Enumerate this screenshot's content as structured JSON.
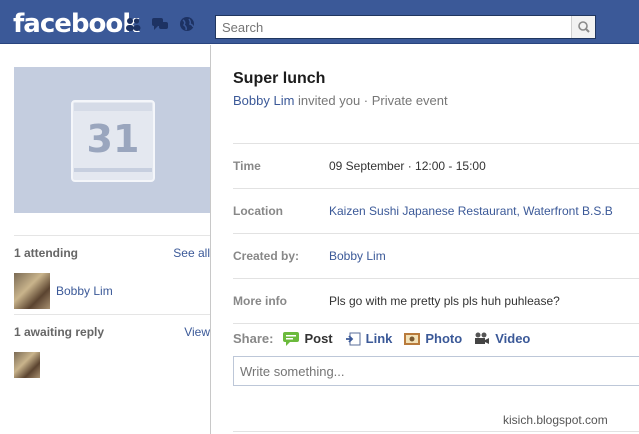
{
  "header": {
    "logo": "facebook",
    "search_placeholder": "Search"
  },
  "left": {
    "calendar_day": "31",
    "attending": {
      "heading": "1 attending",
      "link": "See all",
      "person": "Bobby Lim"
    },
    "awaiting": {
      "heading": "1 awaiting reply",
      "link": "View"
    }
  },
  "event": {
    "title": "Super lunch",
    "host": "Bobby Lim",
    "invite_text": "invited you · Private event",
    "rows": [
      {
        "label": "Time",
        "value": "09 September · 12:00 - 15:00"
      },
      {
        "label": "Location",
        "value": "Kaizen Sushi Japanese Restaurant, Waterfront B.S.B"
      },
      {
        "label": "Created by:",
        "value": "Bobby Lim"
      },
      {
        "label": "More info",
        "value": "Pls go with me pretty pls pls huh puhlease?"
      }
    ]
  },
  "share": {
    "label": "Share:",
    "items": [
      "Post",
      "Link",
      "Photo",
      "Video"
    ],
    "composer_placeholder": "Write something..."
  },
  "watermark": "kisich.blogspot.com",
  "colors": {
    "brand": "#3b5998",
    "link": "#3b5998",
    "photo_bg": "#c4cddf"
  }
}
